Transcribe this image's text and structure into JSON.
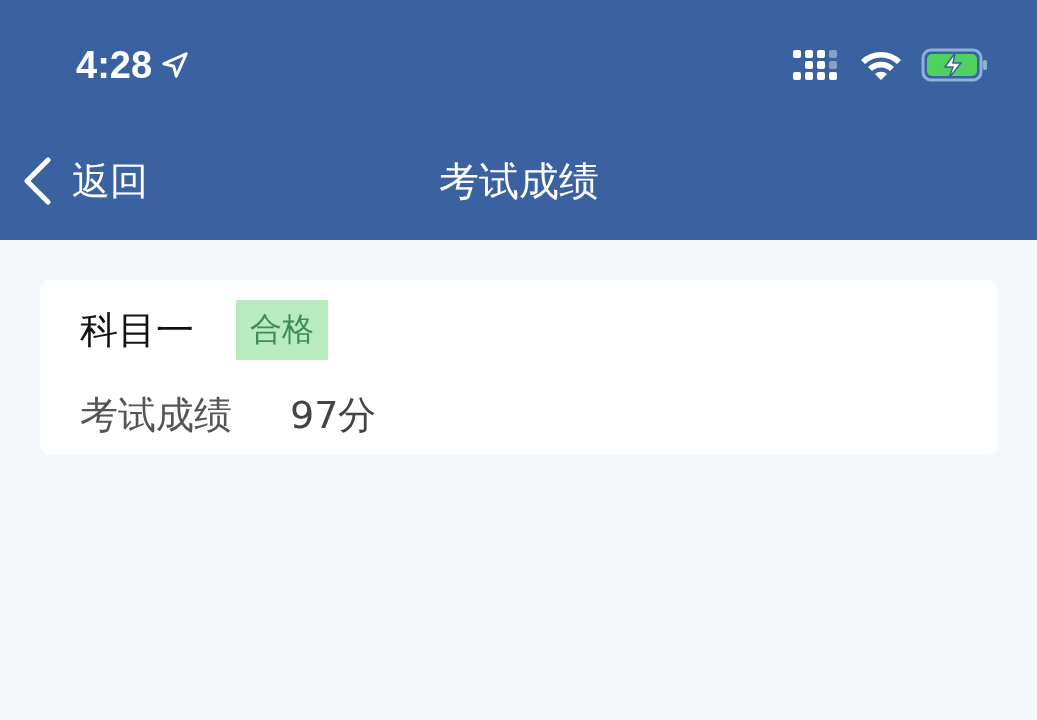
{
  "status_bar": {
    "time": "4:28"
  },
  "nav_bar": {
    "back_label": "返回",
    "title": "考试成绩"
  },
  "results": [
    {
      "subject": "科目一",
      "badge": "合格",
      "score_label": "考试成绩",
      "score": "97分"
    }
  ]
}
